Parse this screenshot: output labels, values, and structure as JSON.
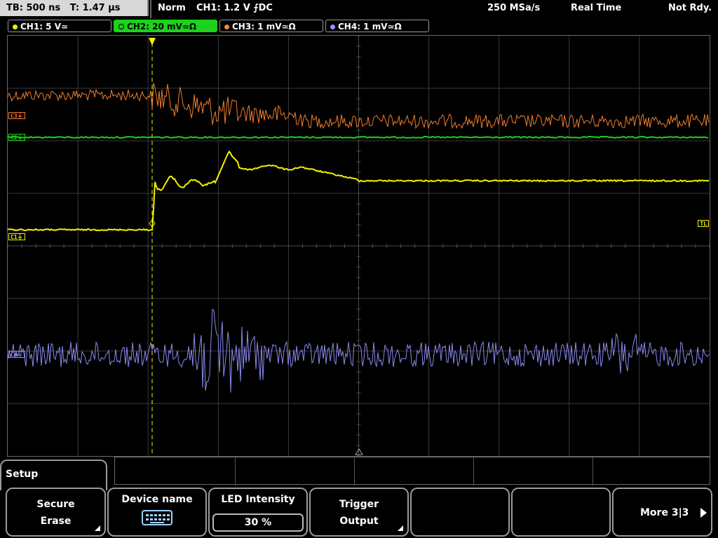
{
  "status_bar": {
    "timebase": "TB: 500 ns",
    "trigger_time": "T: 1.47 µs",
    "mode": "Norm",
    "trigger_info": "CH1: 1.2 V ⨍DC",
    "sample_rate": "250 MSa/s",
    "acquisition": "Real Time",
    "state": "Not Rdy."
  },
  "channel_tabs": [
    {
      "label": "CH1: 5 V≃",
      "color": "#f2f200",
      "active": false
    },
    {
      "label": "CH2: 20 mV≃Ω",
      "color": "#1ad31a",
      "active": true
    },
    {
      "label": "CH3: 1 mV≃Ω",
      "color": "#f08a30",
      "active": false
    },
    {
      "label": "CH4: 1 mV≃Ω",
      "color": "#9494ff",
      "active": false
    }
  ],
  "markers": {
    "c3": "C3⏚",
    "c2": "C2⏚",
    "c1": "C1⏚",
    "c4": "C4⏚",
    "trigger_level": "TL",
    "trigger_pos": "T"
  },
  "colors": {
    "ch1": "#f2f200",
    "ch2": "#1ad31a",
    "ch3": "#f07d2a",
    "ch4": "#8a8af0",
    "grid": "#5a5a5a"
  },
  "menu": {
    "title": "Setup",
    "softkeys": [
      {
        "line1": "Secure",
        "line2": "Erase",
        "has_submenu": true
      },
      {
        "line1": "Device name",
        "icon": "keyboard-icon"
      },
      {
        "line1": "LED Intensity",
        "value": "30 %"
      },
      {
        "line1": "Trigger",
        "line2": "Output",
        "has_submenu": true
      },
      {
        "line1": ""
      },
      {
        "line1": ""
      },
      {
        "line1": "More 3|3",
        "icon": "arrow-right-icon"
      }
    ]
  }
}
